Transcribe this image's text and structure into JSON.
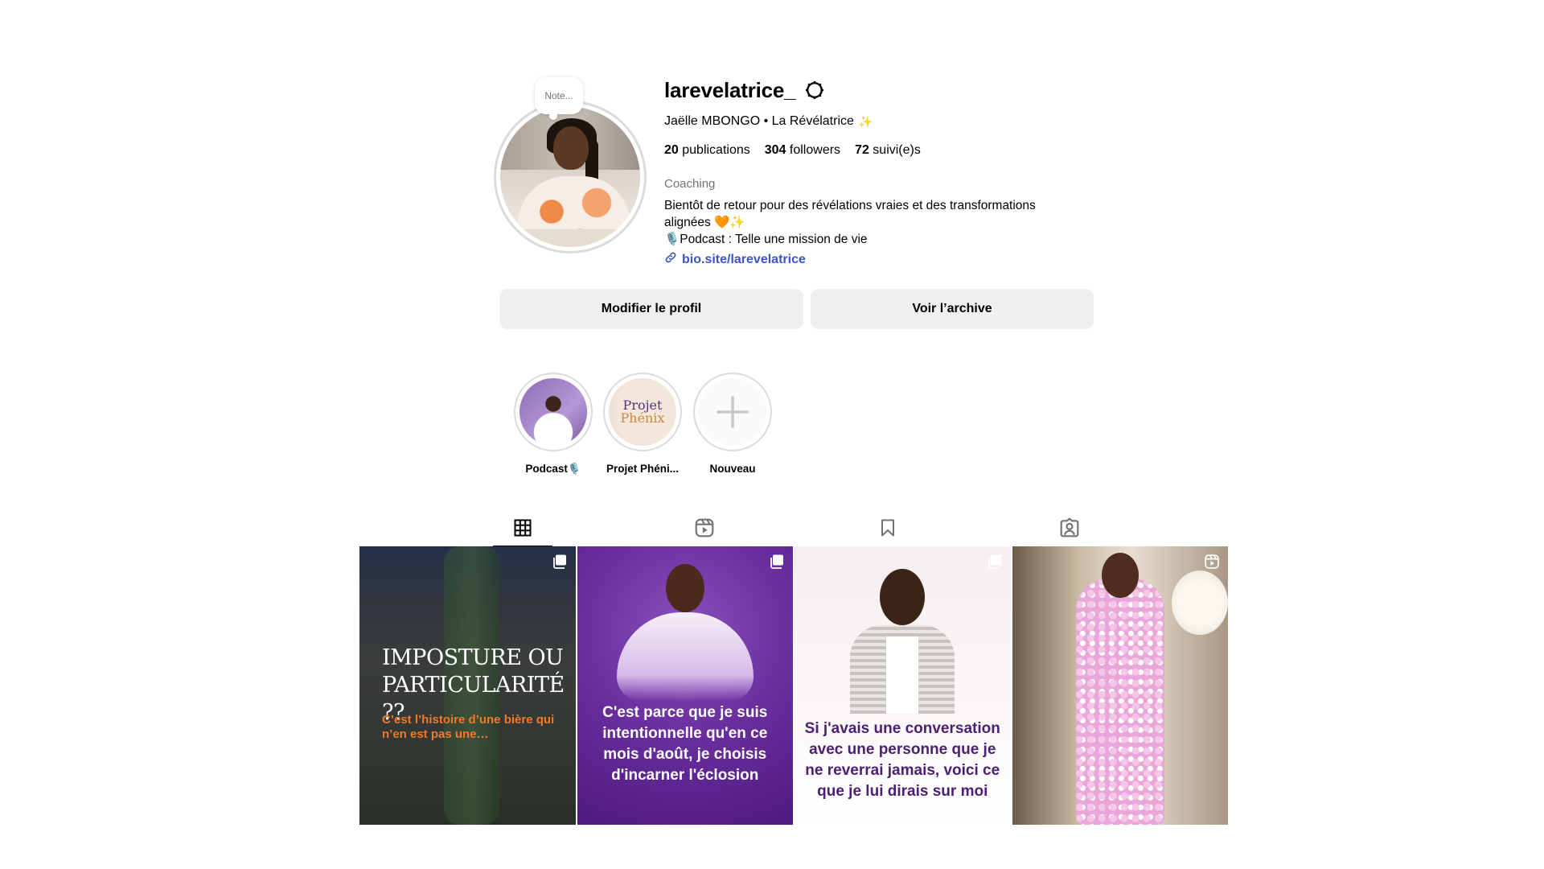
{
  "profile": {
    "note_label": "Note...",
    "username": "larevelatrice_",
    "fullname": "Jaëlle MBONGO • La Révélatrice",
    "fullname_emoji": "✨",
    "stats": {
      "posts_count": "20",
      "posts_label": "publications",
      "followers_count": "304",
      "followers_label": "followers",
      "following_count": "72",
      "following_label": "suivi(e)s"
    },
    "category": "Coaching",
    "bio_line1": "Bientôt de retour pour des révélations vraies et des transformations alignées",
    "bio_line1_emoji": "🧡✨",
    "bio_line2": "🎙️Podcast : Telle une mission de vie",
    "link": "bio.site/larevelatrice"
  },
  "buttons": {
    "edit_profile": "Modifier le profil",
    "view_archive": "Voir l’archive"
  },
  "highlights": [
    {
      "label": "Podcast🎙️"
    },
    {
      "label": "Projet Phéni...",
      "cover_line1": "Projet",
      "cover_line2": "Phénix"
    },
    {
      "label": "Nouveau"
    }
  ],
  "tabs": [
    {
      "icon": "grid-icon",
      "active": true
    },
    {
      "icon": "reels-icon",
      "active": false
    },
    {
      "icon": "bookmark-icon",
      "active": false
    },
    {
      "icon": "tagged-icon",
      "active": false
    }
  ],
  "posts": [
    {
      "type": "carousel",
      "title": "IMPOSTURE OU PARTICULARITÉ ??",
      "subtitle": "C’est l’histoire d’une bière qui n’en est pas une…"
    },
    {
      "type": "carousel",
      "text": "C'est parce que je suis intentionnelle qu'en ce mois d'août, je choisis d'incarner l'éclosion"
    },
    {
      "type": "carousel",
      "text": "Si j'avais une conversation avec une personne que je ne reverrai jamais, voici ce que je lui dirais sur moi"
    },
    {
      "type": "reel"
    }
  ],
  "colors": {
    "link": "#3b54c8",
    "button_bg": "#efefef",
    "divider": "#dbdbdb",
    "secondary_text": "#737373"
  }
}
